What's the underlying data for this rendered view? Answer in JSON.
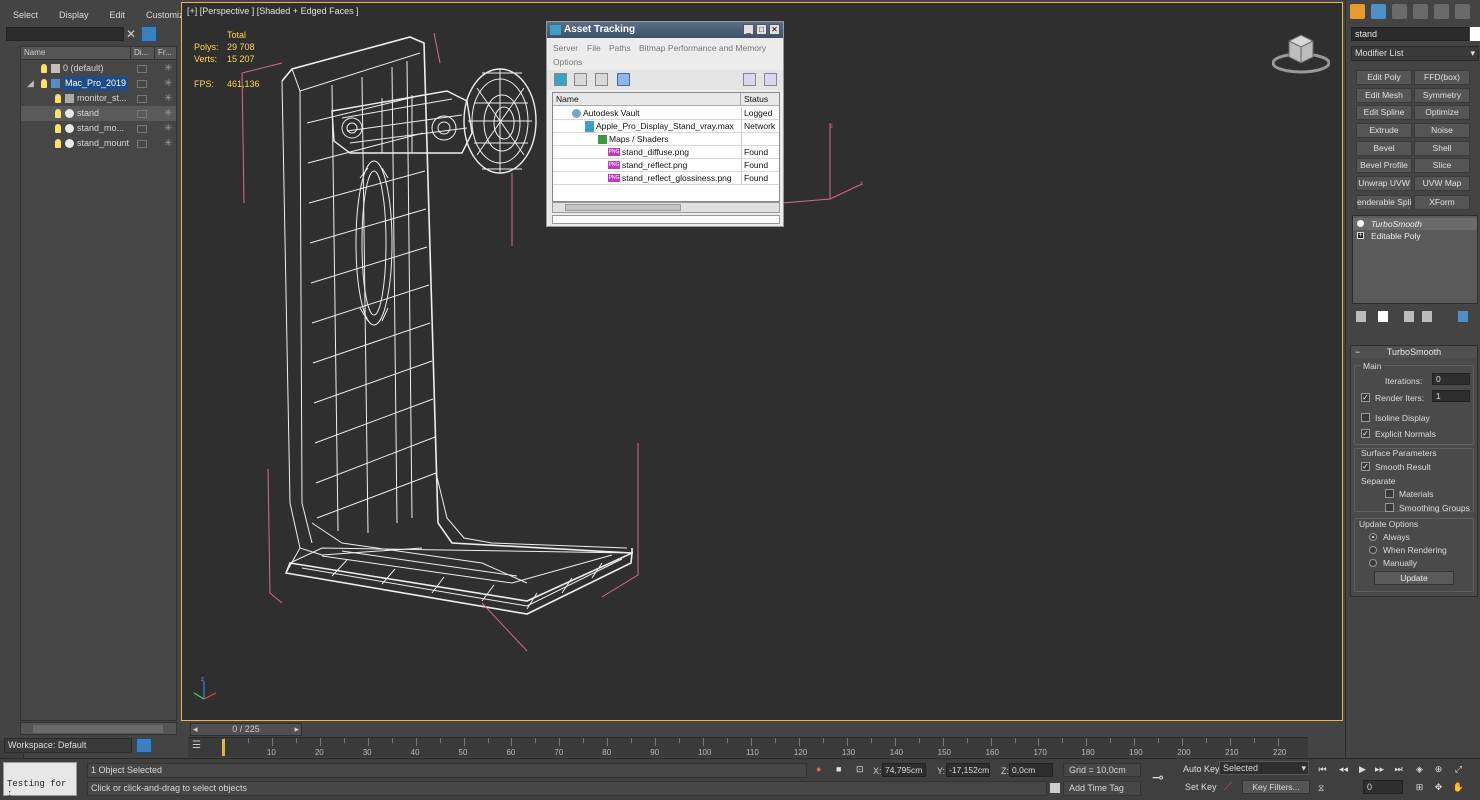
{
  "menu": [
    "Select",
    "Display",
    "Edit",
    "Customize"
  ],
  "explorer": {
    "columns": [
      "Name",
      "Di...",
      "Fr..."
    ],
    "rows": [
      {
        "label": "0 (default)",
        "type": "layer",
        "indent": 0
      },
      {
        "label": "Mac_Pro_2019",
        "type": "layer",
        "indent": 0
      },
      {
        "label": "monitor_st...",
        "type": "group",
        "indent": 1
      },
      {
        "label": "stand",
        "type": "object",
        "indent": 1
      },
      {
        "label": "stand_mo...",
        "type": "object",
        "indent": 1
      },
      {
        "label": "stand_mount",
        "type": "object",
        "indent": 1
      }
    ],
    "workspace": "Workspace: Default"
  },
  "viewport": {
    "label": "[+] [Perspective ] [Shaded + Edged Faces ]",
    "stats": {
      "total_label": "Total",
      "polys_label": "Polys:",
      "polys": "29 708",
      "verts_label": "Verts:",
      "verts": "15 207",
      "fps_label": "FPS:",
      "fps": "461,136"
    },
    "axis_x": "x",
    "axis_z": "z"
  },
  "asset_tracking": {
    "title": "Asset Tracking",
    "menu": [
      "Server",
      "File",
      "Paths",
      "Bitmap Performance and Memory",
      "Options"
    ],
    "columns": [
      "Name",
      "Status"
    ],
    "rows": [
      {
        "name": "Autodesk Vault",
        "status": "Logged",
        "icon": "vault-icon",
        "indent": 1
      },
      {
        "name": "Apple_Pro_Display_Stand_vray.max",
        "status": "Network",
        "icon": "max-file-icon",
        "indent": 2
      },
      {
        "name": "Maps / Shaders",
        "status": "",
        "icon": "maps-icon",
        "indent": 3
      },
      {
        "name": "stand_diffuse.png",
        "status": "Found",
        "icon": "png-icon",
        "indent": 4
      },
      {
        "name": "stand_reflect.png",
        "status": "Found",
        "icon": "png-icon",
        "indent": 4
      },
      {
        "name": "stand_reflect_glossiness.png",
        "status": "Found",
        "icon": "png-icon",
        "indent": 4
      }
    ],
    "png_badge": "PNG"
  },
  "command_panel": {
    "object_name": "stand",
    "modifier_list": "Modifier List",
    "modifier_buttons": [
      "Edit Poly",
      "FFD(box)",
      "Edit Mesh",
      "Symmetry",
      "Edit Spline",
      "Optimize",
      "Extrude",
      "Noise",
      "Bevel",
      "Shell",
      "Bevel Profile",
      "Slice",
      "Unwrap UVW",
      "UVW Map",
      "enderable Splin",
      "XForm"
    ],
    "stack": [
      "TurboSmooth",
      "Editable Poly"
    ],
    "turbosmooth": {
      "title": "TurboSmooth",
      "main": "Main",
      "iterations_label": "Iterations:",
      "iterations": "0",
      "render_iters_label": "Render Iters:",
      "render_iters": "1",
      "render_iters_checked": true,
      "isoline": "Isoline Display",
      "isoline_checked": false,
      "explicit_normals": "Explicit Normals",
      "explicit_normals_checked": true,
      "surface_params": "Surface Parameters",
      "smooth_result": "Smooth Result",
      "smooth_result_checked": true,
      "separate": "Separate",
      "materials": "Materials",
      "smoothing_groups": "Smoothing Groups",
      "update_options": "Update Options",
      "always": "Always",
      "when_rendering": "When Rendering",
      "manually": "Manually",
      "selected_update": "Always",
      "update_button": "Update"
    }
  },
  "timeline": {
    "slider": "0 / 225",
    "labels": [
      "10",
      "20",
      "30",
      "40",
      "50",
      "60",
      "70",
      "80",
      "90",
      "100",
      "110",
      "120",
      "130",
      "140",
      "150",
      "160",
      "170",
      "180",
      "190",
      "200",
      "210",
      "220"
    ]
  },
  "status": {
    "maxscript": "Testing for :",
    "selection": "1 Object Selected",
    "prompt": "Click or click-and-drag to select objects",
    "x_label": "X:",
    "x": "74,795cm",
    "y_label": "Y:",
    "y": "-17,152cm",
    "z_label": "Z:",
    "z": "0,0cm",
    "grid": "Grid = 10,0cm",
    "add_time_tag": "Add Time Tag",
    "auto_key": "Auto Key",
    "set_key": "Set Key",
    "selected": "Selected",
    "key_filters": "Key Filters...",
    "frame": "0"
  }
}
